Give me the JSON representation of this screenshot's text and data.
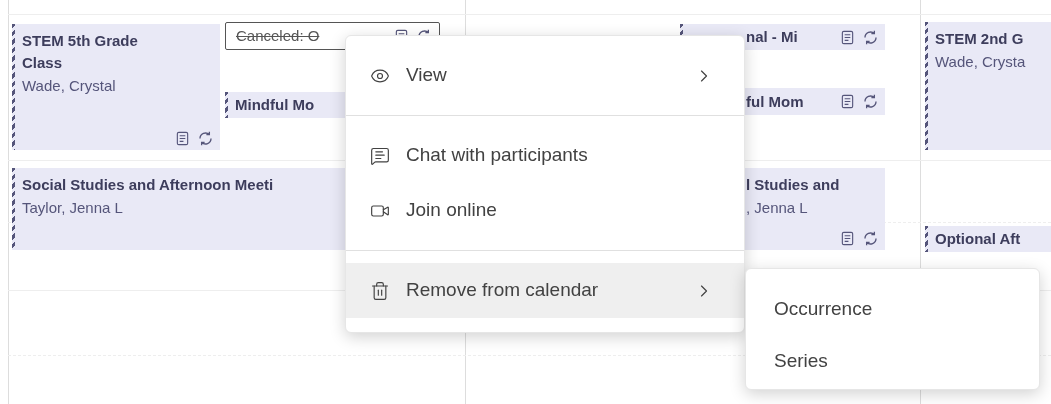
{
  "calendar": {
    "columns": [
      {
        "events": [
          {
            "title": "STEM 5th Grade Class",
            "subtitle": "Wade, Crystal",
            "canceled": false,
            "icons": true
          },
          {
            "title": "Canceled: O",
            "canceled": true,
            "icons": true
          },
          {
            "title": "Mindful Mo",
            "canceled": false,
            "icons": false
          },
          {
            "title": "Social Studies and Afternoon Meeti",
            "subtitle": "Taylor, Jenna L",
            "canceled": false,
            "icons": false
          }
        ]
      },
      {
        "events": [
          {
            "title": "nal - Mi",
            "canceled": false,
            "icons": true
          },
          {
            "title": "ful Mom",
            "canceled": false,
            "icons": true
          },
          {
            "title": "l Studies and",
            "subtitle": ", Jenna L",
            "canceled": false,
            "icons": true
          }
        ]
      },
      {
        "events": [
          {
            "title": "STEM 2nd G",
            "subtitle": "Wade, Crysta",
            "canceled": false,
            "icons": false
          },
          {
            "title": "Optional Aft",
            "canceled": false,
            "icons": false
          }
        ]
      }
    ]
  },
  "context_menu": {
    "items": [
      {
        "kind": "item",
        "label": "View",
        "submenu": true,
        "selected": false
      },
      {
        "kind": "divider"
      },
      {
        "kind": "item",
        "label": "Chat with participants",
        "submenu": false,
        "selected": false
      },
      {
        "kind": "item",
        "label": "Join online",
        "submenu": false,
        "selected": false
      },
      {
        "kind": "divider"
      },
      {
        "kind": "item",
        "label": "Remove from calendar",
        "submenu": true,
        "selected": true
      }
    ]
  },
  "submenu": {
    "items": [
      {
        "label": "Occurrence"
      },
      {
        "label": "Series"
      }
    ]
  }
}
